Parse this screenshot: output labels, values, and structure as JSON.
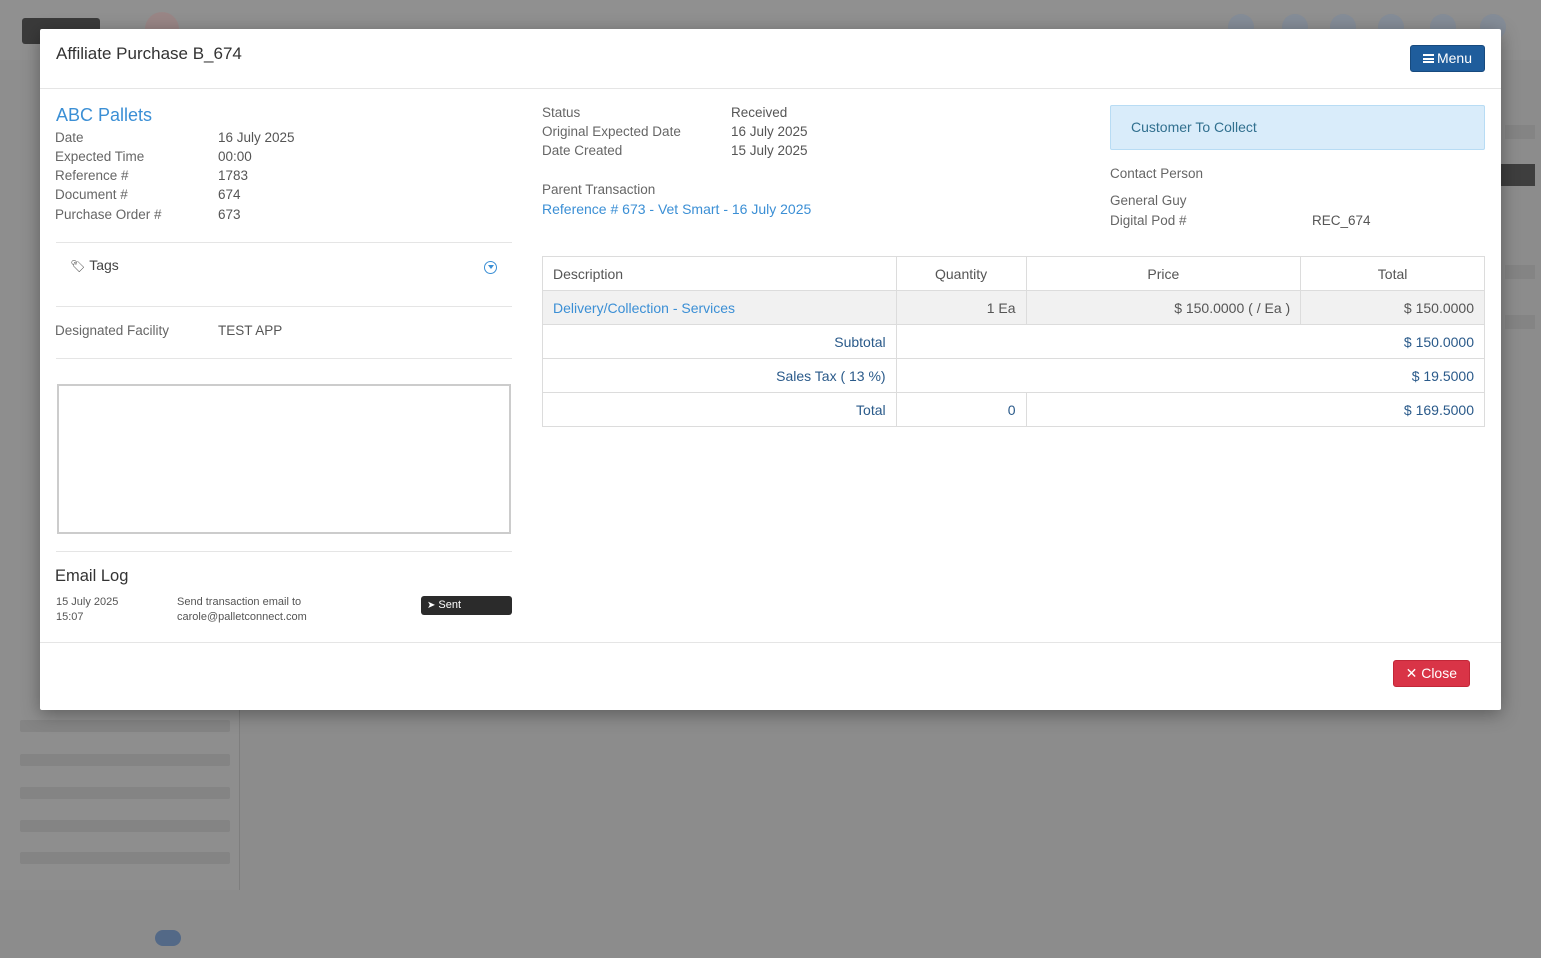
{
  "modal": {
    "title": "Affiliate Purchase B_674",
    "menu_label": "Menu",
    "close_label": "Close"
  },
  "left": {
    "supplier": "ABC Pallets",
    "fields": [
      {
        "label": "Date",
        "value": "16 July 2025"
      },
      {
        "label": "Expected Time",
        "value": "00:00"
      },
      {
        "label": "Reference #",
        "value": "1783"
      },
      {
        "label": "Document #",
        "value": "674"
      },
      {
        "label": "Purchase Order #",
        "value": "673"
      }
    ],
    "tags_label": "Tags",
    "facility_label": "Designated Facility",
    "facility_value": "TEST APP",
    "notes_value": "",
    "email_log": {
      "title": "Email Log",
      "entries": [
        {
          "date": "15 July 2025",
          "time": "15:07",
          "line1": "Send transaction email to",
          "line2": "carole@palletconnect.com",
          "status": "Sent"
        }
      ]
    }
  },
  "middle": {
    "fields": [
      {
        "label": "Status",
        "value": "Received"
      },
      {
        "label": "Original Expected Date",
        "value": "16 July 2025"
      },
      {
        "label": "Date Created",
        "value": "15 July 2025"
      }
    ],
    "parent_label": "Parent Transaction",
    "parent_link": "Reference # 673 - Vet Smart - 16 July 2025"
  },
  "right": {
    "collect_label": "Customer To Collect",
    "contact_label": "Contact Person",
    "contact_value": "General Guy",
    "pod_label": "Digital Pod #",
    "pod_value": "REC_674"
  },
  "table": {
    "headers": [
      "Description",
      "Quantity",
      "Price",
      "Total"
    ],
    "items": [
      {
        "description": "Delivery/Collection - Services",
        "quantity": "1 Ea",
        "price": "$ 150.0000 ( / Ea )",
        "total": "$ 150.0000"
      }
    ],
    "subtotal_label": "Subtotal",
    "subtotal_value": "$ 150.0000",
    "tax_label": "Sales Tax ( 13 %)",
    "tax_value": "$ 19.5000",
    "total_label": "Total",
    "total_quantity": "0",
    "total_value": "$ 169.5000"
  },
  "colors": {
    "primary": "#1f5d9c",
    "link": "#3b8fd5",
    "danger": "#d93447",
    "info_bg": "#d9ecfa"
  }
}
